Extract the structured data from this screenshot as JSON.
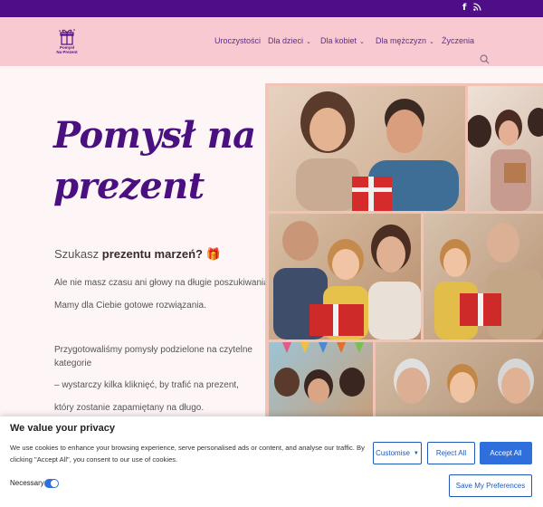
{
  "topbar": {
    "social": [
      "f",
      "rss"
    ]
  },
  "logo": {
    "line1": "Pomysł",
    "line2": "Na Prezent"
  },
  "nav": {
    "items": [
      {
        "label": "Uroczystości",
        "has_dropdown": false
      },
      {
        "label": "Dla dzieci",
        "has_dropdown": true
      },
      {
        "label": "Dla kobiet",
        "has_dropdown": true
      },
      {
        "label": "Dla mężczyzn",
        "has_dropdown": true
      },
      {
        "label": "Życzenia",
        "has_dropdown": false
      }
    ],
    "search_icon": "search-icon"
  },
  "hero": {
    "title": "Pomysł na prezent",
    "subhead_prefix": "Szukasz ",
    "subhead_bold": "prezentu marzeń?",
    "subhead_emoji": "🎁",
    "p1": "Ale nie masz czasu ani głowy na długie poszukiwania?",
    "p2": "Mamy dla Ciebie gotowe rozwiązania.",
    "p3": "Przygotowaliśmy pomysły podzielone na czytelne kategorie",
    "p4": "– wystarczy kilka kliknięć, by trafić na prezent,",
    "p5": "który zostanie zapamiętany na długo."
  },
  "colors": {
    "topbar": "#4e0f86",
    "header": "#f8c9d1",
    "title": "#4a1080",
    "accent": "#2f6fdc"
  },
  "cookie": {
    "title": "We value your privacy",
    "text": "We use cookies to enhance your browsing experience, serve personalised ads or content, and analyse our traffic. By clicking \"Accept All\", you consent to our use of cookies.",
    "customise": "Customise",
    "reject": "Reject All",
    "accept": "Accept All",
    "necessary": "Necessary",
    "save": "Save My Preferences"
  }
}
